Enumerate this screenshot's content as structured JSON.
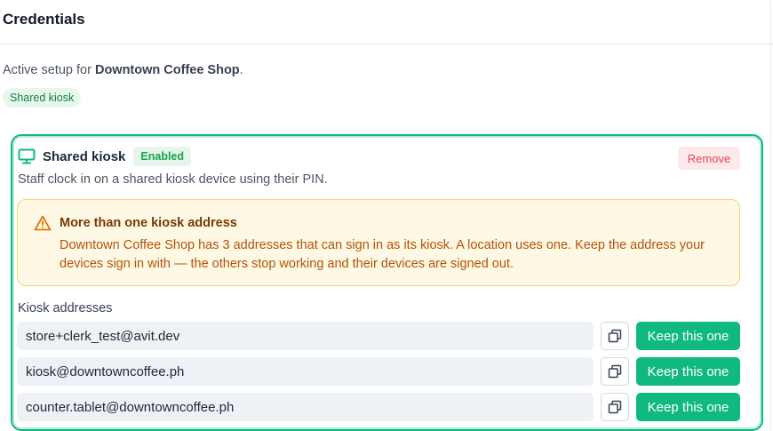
{
  "header": {
    "title": "Credentials"
  },
  "active_setup": {
    "prefix": "Active setup for ",
    "location": "Downtown Coffee Shop",
    "suffix": "."
  },
  "setup_badge": "Shared kiosk",
  "kiosk": {
    "title": "Shared kiosk",
    "status": "Enabled",
    "remove_label": "Remove",
    "description": "Staff clock in on a shared kiosk device using their PIN.",
    "warning": {
      "title": "More than one kiosk address",
      "body": "Downtown Coffee Shop has 3 addresses that can sign in as its kiosk. A location uses one. Keep the address your devices sign in with — the others stop working and their devices are signed out."
    },
    "addresses_label": "Kiosk addresses",
    "addresses": [
      {
        "value": "store+clerk_test@avit.dev",
        "keep_label": "Keep this one"
      },
      {
        "value": "kiosk@downtowncoffee.ph",
        "keep_label": "Keep this one"
      },
      {
        "value": "counter.tablet@downtowncoffee.ph",
        "keep_label": "Keep this one"
      }
    ]
  },
  "icons": {
    "kiosk": "monitor-icon",
    "warning": "warning-triangle-icon",
    "copy": "copy-icon"
  },
  "colors": {
    "accent": "#10b981",
    "danger": "#e24a5a",
    "warning_bg": "#fef8e4"
  }
}
